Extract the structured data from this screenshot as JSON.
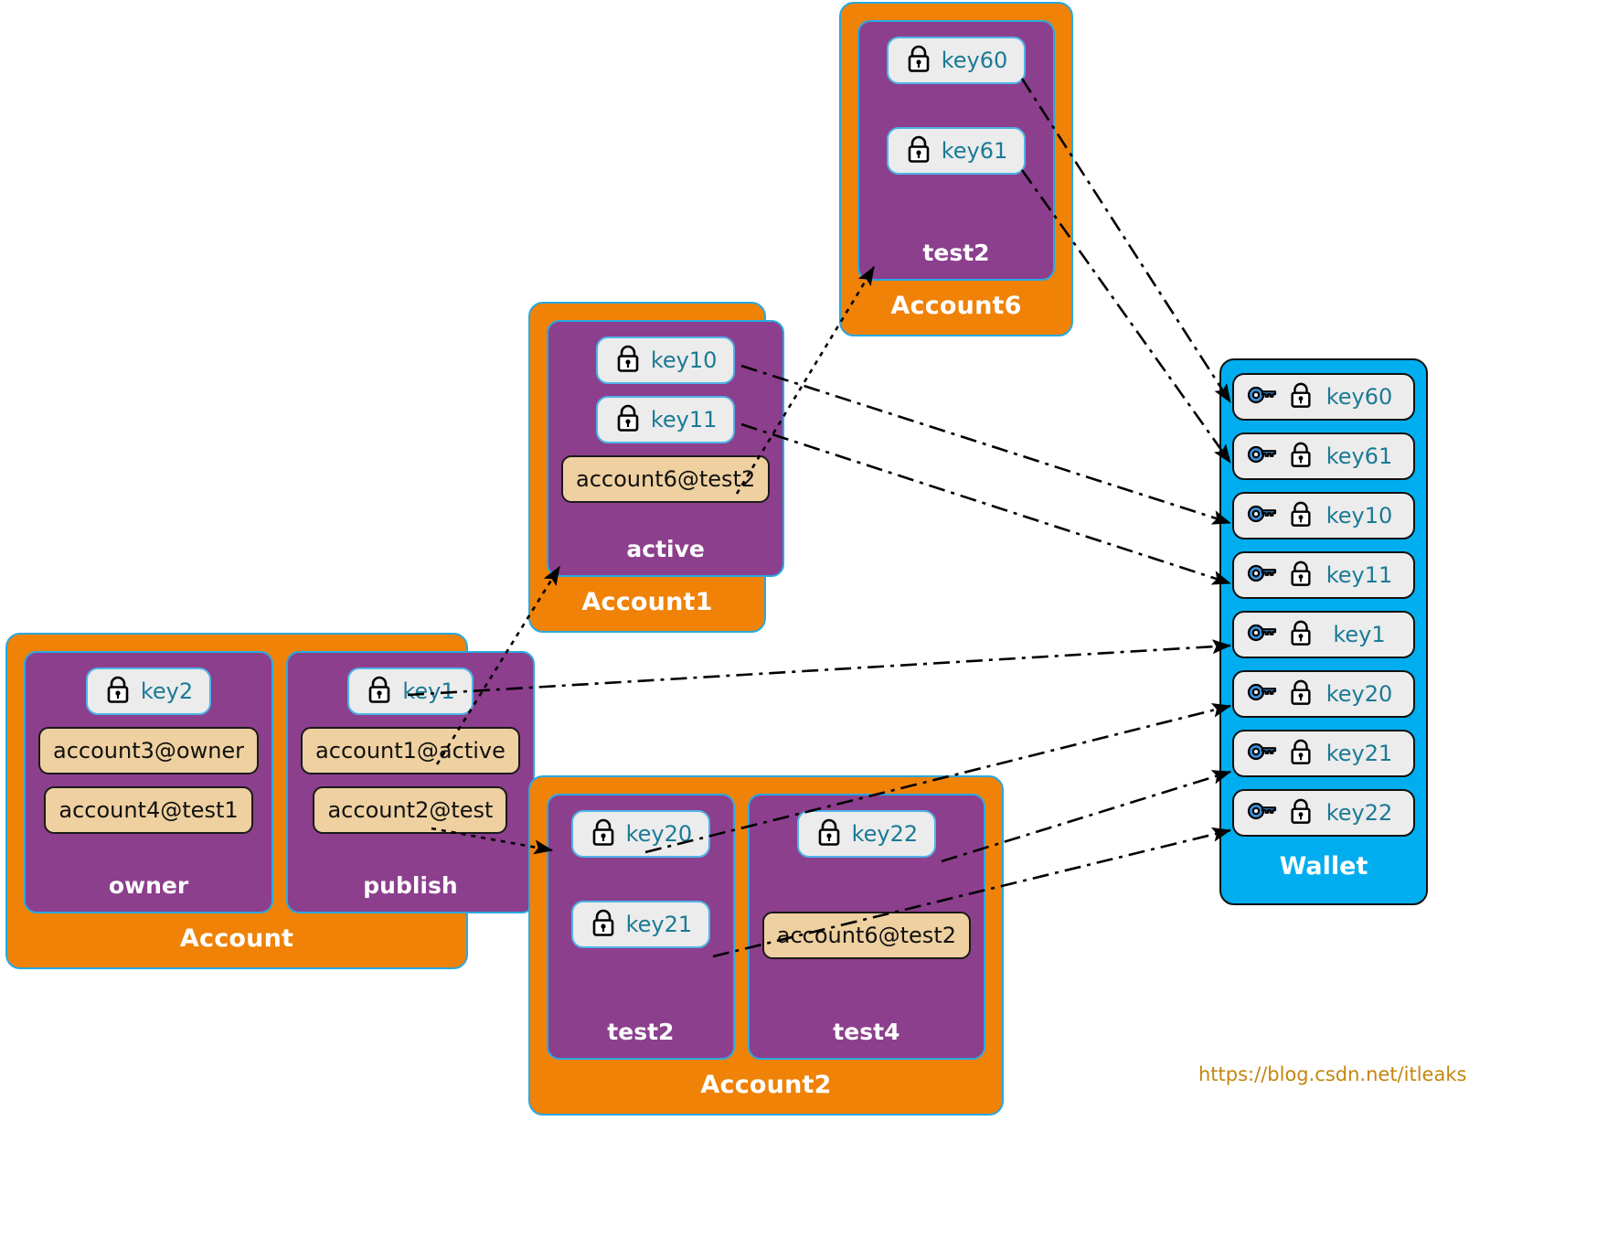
{
  "colors": {
    "group_fill": "#ef8207",
    "group_border": "#29a9e1",
    "permission_fill": "#8c3f8c",
    "key_chip_fill": "#ececec",
    "key_chip_border": "#4fb3e8",
    "key_text": "#1b7a96",
    "account_chip_fill": "#efd0a0",
    "wallet_fill": "#00aeef",
    "watermark_text": "#c4860f",
    "edge_stroke": "#000000",
    "label_text": "#ffffff",
    "background": "#ffffff"
  },
  "groups": [
    {
      "id": "account",
      "label": "Account",
      "permissions": [
        {
          "id": "owner",
          "label": "owner",
          "keys": [
            {
              "name": "key2",
              "icon": "lock-icon"
            }
          ],
          "accounts": [
            "account3@owner",
            "account4@test1"
          ]
        },
        {
          "id": "publish",
          "label": "publish",
          "keys": [
            {
              "name": "key1",
              "icon": "lock-icon"
            }
          ],
          "accounts": [
            "account1@active",
            "account2@test"
          ]
        }
      ]
    },
    {
      "id": "account1",
      "label": "Account1",
      "permissions": [
        {
          "id": "active",
          "label": "active",
          "keys": [
            {
              "name": "key10",
              "icon": "lock-icon"
            },
            {
              "name": "key11",
              "icon": "lock-icon"
            }
          ],
          "accounts": [
            "account6@test2"
          ]
        }
      ]
    },
    {
      "id": "account6",
      "label": "Account6",
      "permissions": [
        {
          "id": "account6-test2",
          "label": "test2",
          "keys": [
            {
              "name": "key60",
              "icon": "lock-icon"
            },
            {
              "name": "key61",
              "icon": "lock-icon"
            }
          ],
          "accounts": []
        }
      ]
    },
    {
      "id": "account2",
      "label": "Account2",
      "permissions": [
        {
          "id": "account2-test2",
          "label": "test2",
          "keys": [
            {
              "name": "key20",
              "icon": "lock-icon"
            },
            {
              "name": "key21",
              "icon": "lock-icon"
            }
          ],
          "accounts": []
        },
        {
          "id": "account2-test4",
          "label": "test4",
          "keys": [
            {
              "name": "key22",
              "icon": "lock-icon"
            }
          ],
          "accounts": [
            "account6@test2"
          ]
        }
      ]
    }
  ],
  "wallet": {
    "label": "Wallet",
    "items": [
      {
        "name": "key60",
        "icons": [
          "key-icon",
          "lock-icon"
        ]
      },
      {
        "name": "key61",
        "icons": [
          "key-icon",
          "lock-icon"
        ]
      },
      {
        "name": "key10",
        "icons": [
          "key-icon",
          "lock-icon"
        ]
      },
      {
        "name": "key11",
        "icons": [
          "key-icon",
          "lock-icon"
        ]
      },
      {
        "name": "key1",
        "icons": [
          "key-icon",
          "lock-icon"
        ]
      },
      {
        "name": "key20",
        "icons": [
          "key-icon",
          "lock-icon"
        ]
      },
      {
        "name": "key21",
        "icons": [
          "key-icon",
          "lock-icon"
        ]
      },
      {
        "name": "key22",
        "icons": [
          "key-icon",
          "lock-icon"
        ]
      }
    ]
  },
  "watermark": "https://blog.csdn.net/itleaks",
  "edges": [
    {
      "from": "key60",
      "to": "wallet-key60",
      "style": "dash-dot"
    },
    {
      "from": "key61",
      "to": "wallet-key61",
      "style": "dash-dot"
    },
    {
      "from": "key10",
      "to": "wallet-key10",
      "style": "dash-dot"
    },
    {
      "from": "key11",
      "to": "wallet-key11",
      "style": "dash-dot"
    },
    {
      "from": "key1",
      "to": "wallet-key1",
      "style": "dash-dot"
    },
    {
      "from": "key20",
      "to": "wallet-key20",
      "style": "dash-dot"
    },
    {
      "from": "key21",
      "to": "wallet-key21",
      "style": "dash-dot"
    },
    {
      "from": "key22",
      "to": "wallet-key22",
      "style": "dash-dot"
    },
    {
      "from": "account1@active",
      "to": "account1-active",
      "style": "dotted"
    },
    {
      "from": "account2@test",
      "to": "account2-test2",
      "style": "dotted"
    },
    {
      "from": "account6@test2",
      "to": "account6-test2",
      "style": "dotted"
    }
  ]
}
